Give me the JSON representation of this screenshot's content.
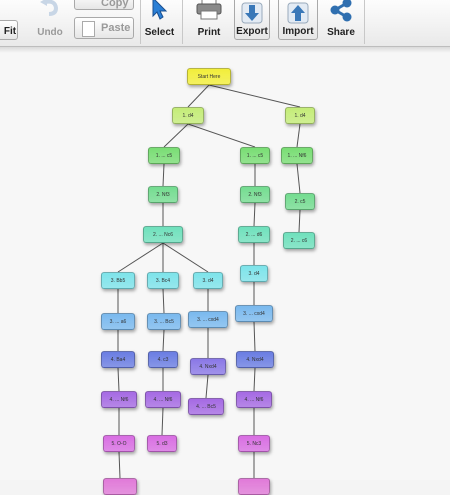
{
  "toolbar": {
    "fit_label": "Fit",
    "undo_label": "Undo",
    "copy_label": "Copy",
    "paste_label": "Paste",
    "select_label": "Select",
    "print_label": "Print",
    "export_label": "Export",
    "import_label": "Import",
    "share_label": "Share"
  },
  "tree": {
    "root": "Start Here",
    "nodes": [
      {
        "id": "root",
        "label": "Start Here",
        "color": "#f2ee3a",
        "parent": null
      },
      {
        "id": "a1",
        "label": "1. d4",
        "color": "#c4ec78",
        "parent": "root"
      },
      {
        "id": "b1",
        "label": "1. d4",
        "color": "#c4ec78",
        "parent": "root"
      },
      {
        "id": "a2",
        "label": "1. ... c5",
        "color": "#79dd74",
        "parent": "a1"
      },
      {
        "id": "c2",
        "label": "1. ... c5",
        "color": "#79dd74",
        "parent": "a1"
      },
      {
        "id": "b2",
        "label": "1. ... Nf6",
        "color": "#79dd74",
        "parent": "b1"
      },
      {
        "id": "a3",
        "label": "2. Nf3",
        "color": "#74dc90",
        "parent": "a2"
      },
      {
        "id": "c3",
        "label": "2. Nf3",
        "color": "#74dc90",
        "parent": "c2"
      },
      {
        "id": "b3",
        "label": "2. c5",
        "color": "#74dc90",
        "parent": "b2"
      },
      {
        "id": "a4",
        "label": "2. ... Nc6",
        "color": "#6fe0bc",
        "parent": "a3"
      },
      {
        "id": "c4",
        "label": "2. ... d6",
        "color": "#6fe0bc",
        "parent": "c3"
      },
      {
        "id": "b4",
        "label": "2. ... c6",
        "color": "#6fe0bc",
        "parent": "b3"
      },
      {
        "id": "d5",
        "label": "3. Bb5",
        "color": "#7de3ea",
        "parent": "a4"
      },
      {
        "id": "e5",
        "label": "3. Bc4",
        "color": "#7de3ea",
        "parent": "a4"
      },
      {
        "id": "f5",
        "label": "3. d4",
        "color": "#7de3ea",
        "parent": "a4"
      },
      {
        "id": "c5",
        "label": "3. d4",
        "color": "#7de3ea",
        "parent": "c4"
      },
      {
        "id": "d6",
        "label": "3. ... a6",
        "color": "#7ab9ee",
        "parent": "d5"
      },
      {
        "id": "e6",
        "label": "3. ... Bc5",
        "color": "#7ab9ee",
        "parent": "e5"
      },
      {
        "id": "f6",
        "label": "3. ... cxd4",
        "color": "#7ab9ee",
        "parent": "f5"
      },
      {
        "id": "c6",
        "label": "3. ... cxd4",
        "color": "#7ab9ee",
        "parent": "c5"
      },
      {
        "id": "d7",
        "label": "4. Ba4",
        "color": "#6a7de2",
        "parent": "d6"
      },
      {
        "id": "e7",
        "label": "4. c3",
        "color": "#6a7de2",
        "parent": "e6"
      },
      {
        "id": "f7",
        "label": "4. Nxd4",
        "color": "#8a78e6",
        "parent": "f6"
      },
      {
        "id": "c7",
        "label": "4. Nxd4",
        "color": "#6a7de2",
        "parent": "c6"
      },
      {
        "id": "d8",
        "label": "4. ... Nf6",
        "color": "#a56ae3",
        "parent": "d7"
      },
      {
        "id": "e8",
        "label": "4. ... Nf6",
        "color": "#a56ae3",
        "parent": "e7"
      },
      {
        "id": "f8",
        "label": "4. ... Bc5",
        "color": "#a56ae3",
        "parent": "f7"
      },
      {
        "id": "c8",
        "label": "4. ... Nf6",
        "color": "#a56ae3",
        "parent": "c7"
      },
      {
        "id": "d9",
        "label": "5. O-O",
        "color": "#d86ee2",
        "parent": "d8"
      },
      {
        "id": "e9",
        "label": "5. d3",
        "color": "#d86ee2",
        "parent": "e8"
      },
      {
        "id": "c9",
        "label": "5. Nc3",
        "color": "#d86ee2",
        "parent": "c8"
      },
      {
        "id": "d10",
        "label": "",
        "color": "#e07ad8",
        "parent": "d9"
      },
      {
        "id": "c10",
        "label": "",
        "color": "#e07ad8",
        "parent": "c9"
      }
    ]
  }
}
